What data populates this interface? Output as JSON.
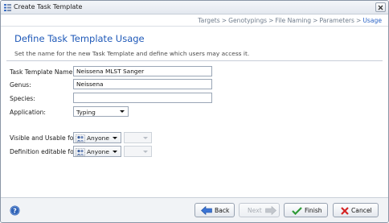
{
  "window": {
    "title": "Create Task Template"
  },
  "breadcrumb": {
    "steps": [
      "Targets",
      "Genotypings",
      "File Naming",
      "Parameters",
      "Usage"
    ],
    "separator": ">"
  },
  "page": {
    "title": "Define Task Template Usage",
    "subtitle": "Set the name for the new Task Template and define which users may access it."
  },
  "form": {
    "name_label": "Task Template Name:",
    "name_value": "Neissena MLST Sanger",
    "genus_label": "Genus:",
    "genus_value": "Neissena",
    "species_label": "Species:",
    "species_value": "",
    "application_label": "Application:",
    "application_value": "Typing"
  },
  "permissions": {
    "visible_label": "Visible and Usable for:",
    "visible_value": "Anyone",
    "editable_label": "Definition editable for:",
    "editable_value": "Anyone"
  },
  "footer": {
    "back_label": "Back",
    "next_label": "Next",
    "finish_label": "Finish",
    "cancel_label": "Cancel"
  },
  "colors": {
    "accent": "#1f59b8",
    "breadcrumb_current": "#2a63c6"
  }
}
